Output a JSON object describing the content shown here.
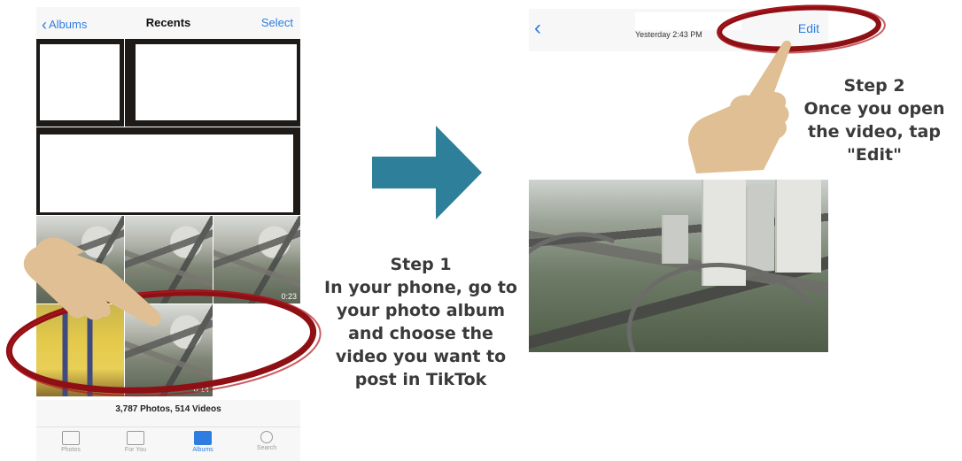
{
  "albums_screen": {
    "back_label": "Albums",
    "title": "Recents",
    "select_label": "Select",
    "thumbnails": [
      {
        "duration": "0:23"
      },
      {
        "duration": "0:14"
      }
    ],
    "count_text": "3,787 Photos, 514 Videos",
    "tabs": [
      {
        "label": "Photos",
        "icon": "photos-icon",
        "active": false
      },
      {
        "label": "For You",
        "icon": "for-you-icon",
        "active": false
      },
      {
        "label": "Albums",
        "icon": "albums-icon",
        "active": true
      },
      {
        "label": "Search",
        "icon": "search-icon",
        "active": false
      }
    ]
  },
  "video_screen": {
    "back_icon": "chevron-left-icon",
    "date_text": "Yesterday  2:43 PM",
    "edit_label": "Edit"
  },
  "step1": {
    "title": "Step 1",
    "lines": [
      "In your phone, go to",
      "your photo album",
      "and choose the",
      "video you want to",
      "post in TikTok"
    ]
  },
  "step2": {
    "title": "Step 2",
    "lines": [
      "Once you open",
      "the video, tap",
      "\"Edit\""
    ]
  },
  "colors": {
    "accent_blue": "#2f7de1",
    "arrow_teal": "#2e7f9a",
    "highlight_red": "#8e0f14",
    "hand_skin": "#dfbf93",
    "instruction_text": "#3a3a3a"
  }
}
